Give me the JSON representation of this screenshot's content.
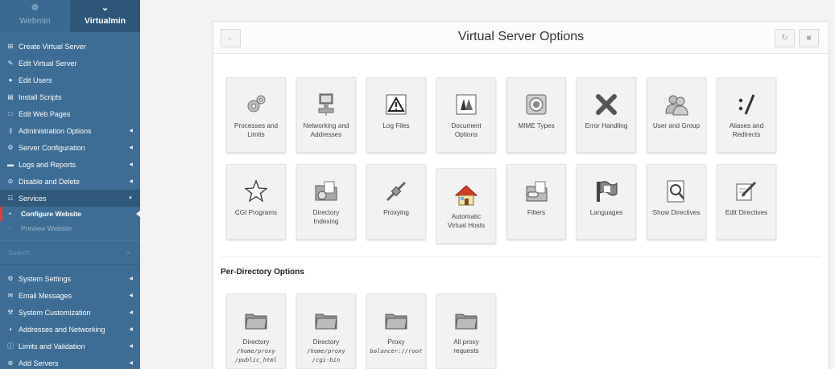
{
  "sidebar": {
    "tabs": {
      "webmin": "Webmin",
      "virtualmin": "Virtualmin"
    },
    "menu": [
      {
        "label": "Create Virtual Server",
        "icon": "plus-square-icon"
      },
      {
        "label": "Edit Virtual Server",
        "icon": "edit-icon"
      },
      {
        "label": "Edit Users",
        "icon": "users-icon"
      },
      {
        "label": "Install Scripts",
        "icon": "script-icon"
      },
      {
        "label": "Edit Web Pages",
        "icon": "file-icon"
      },
      {
        "label": "Administration Options",
        "icon": "key-icon"
      },
      {
        "label": "Server Configuration",
        "icon": "cogs-icon"
      },
      {
        "label": "Logs and Reports",
        "icon": "folder-icon"
      },
      {
        "label": "Disable and Delete",
        "icon": "ban-icon"
      },
      {
        "label": "Services",
        "icon": "sitemap-icon"
      }
    ],
    "submenu": [
      {
        "label": "Configure Website"
      },
      {
        "label": "Preview Website"
      }
    ],
    "search_placeholder": "Search",
    "menu2": [
      {
        "label": "System Settings",
        "icon": "cog-icon"
      },
      {
        "label": "Email Messages",
        "icon": "envelope-icon"
      },
      {
        "label": "System Customization",
        "icon": "wrench-icon"
      },
      {
        "label": "Addresses and Networking",
        "icon": "shield-icon"
      },
      {
        "label": "Limits and Validation",
        "icon": "info-circle-icon"
      },
      {
        "label": "Add Servers",
        "icon": "plus-circle-icon"
      }
    ]
  },
  "page": {
    "title": "Virtual Server Options",
    "per_directory_title": "Per-Directory Options"
  },
  "tiles": [
    {
      "lines": [
        "Processes and",
        "Limits"
      ],
      "icon": "gears-icon"
    },
    {
      "lines": [
        "Networking and",
        "Addresses"
      ],
      "icon": "network-computer-icon"
    },
    {
      "lines": [
        "Log Files"
      ],
      "icon": "warning-log-icon"
    },
    {
      "lines": [
        "Document",
        "Options"
      ],
      "icon": "document-icon"
    },
    {
      "lines": [
        "MIME Types"
      ],
      "icon": "mime-icon"
    },
    {
      "lines": [
        "Error Handling"
      ],
      "icon": "error-x-icon"
    },
    {
      "lines": [
        "User and Group"
      ],
      "icon": "user-group-icon"
    },
    {
      "lines": [
        "Aliases and",
        "Redirects"
      ],
      "icon": "aliases-icon"
    },
    {
      "lines": [
        "CGI Programs"
      ],
      "icon": "star-icon"
    },
    {
      "lines": [
        "Directory",
        "Indexing"
      ],
      "icon": "folder-index-icon"
    },
    {
      "lines": [
        "Proxying"
      ],
      "icon": "proxy-plug-icon"
    },
    {
      "lines": [
        "Automatic",
        "Virtual Hosts"
      ],
      "icon": "house-icon"
    },
    {
      "lines": [
        "Filters"
      ],
      "icon": "filter-folder-icon"
    },
    {
      "lines": [
        "Languages"
      ],
      "icon": "flag-icon"
    },
    {
      "lines": [
        "Show Directives"
      ],
      "icon": "magnifier-doc-icon"
    },
    {
      "lines": [
        "Edit Directives"
      ],
      "icon": "edit-doc-icon"
    }
  ],
  "dir_tiles": [
    {
      "label": "Directory",
      "path": [
        "/home/proxy",
        "/public_html"
      ],
      "icon": "folder-icon"
    },
    {
      "label": "Directory",
      "path": [
        "/home/proxy",
        "/cgi-bin"
      ],
      "icon": "folder-icon"
    },
    {
      "label": "Proxy",
      "path": [
        "balancer://root"
      ],
      "icon": "folder-icon"
    },
    {
      "label": "All proxy",
      "label2": "requests",
      "path": [],
      "icon": "folder-icon"
    }
  ]
}
